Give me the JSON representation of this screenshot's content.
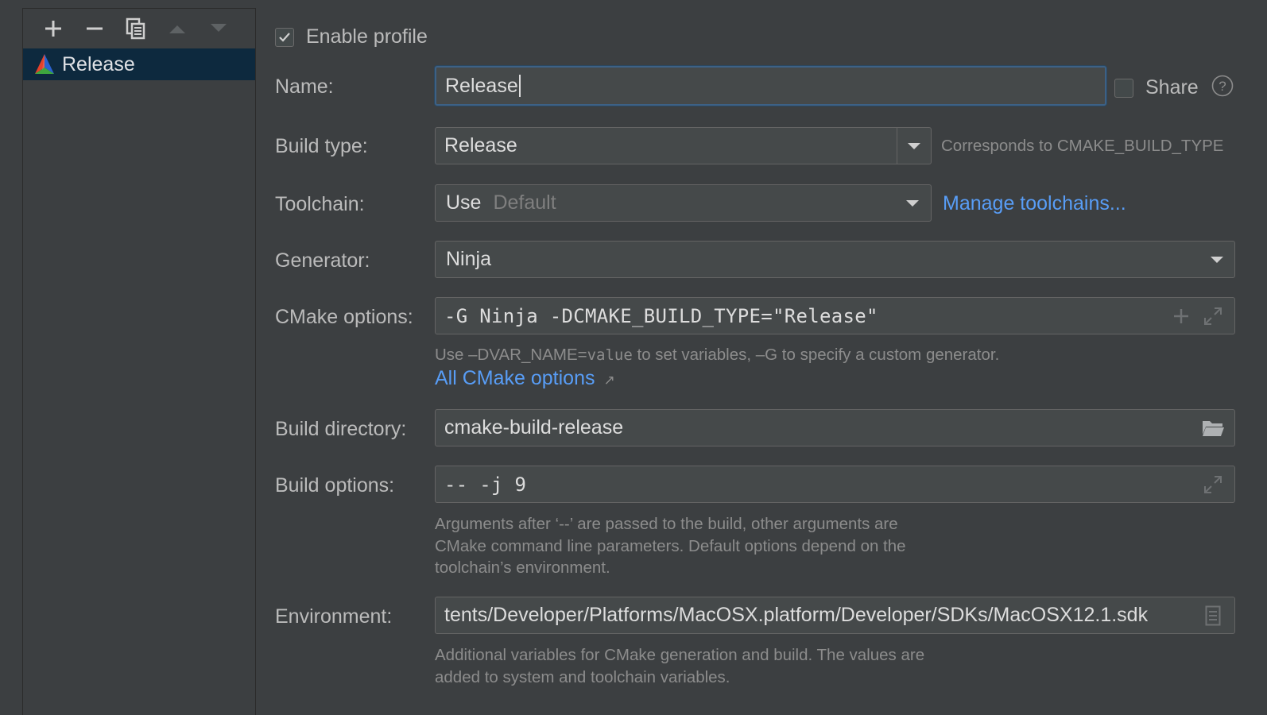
{
  "profiles": {
    "items": [
      {
        "label": "Release",
        "icon": "cmake-logo-icon"
      }
    ],
    "toolbar_icons": [
      "add-icon",
      "remove-icon",
      "copy-icon",
      "move-up-icon",
      "move-down-icon"
    ]
  },
  "form": {
    "enable_profile_label": "Enable profile",
    "enable_profile_checked": true,
    "name_label": "Name:",
    "name_value": "Release",
    "share_label": "Share",
    "share_checked": false,
    "build_type_label": "Build type:",
    "build_type_value": "Release",
    "build_type_hint": "Corresponds to CMAKE_BUILD_TYPE",
    "toolchain_label": "Toolchain:",
    "toolchain_use": "Use",
    "toolchain_value": "Default",
    "manage_toolchains_link": "Manage toolchains...",
    "generator_label": "Generator:",
    "generator_value": "Ninja",
    "cmake_options_label": "CMake options:",
    "cmake_options_value": "-G Ninja -DCMAKE_BUILD_TYPE=\"Release\"",
    "cmake_hint_1": "Use –DVAR_NAME=",
    "cmake_hint_code": "value",
    "cmake_hint_2": " to set variables, –G to specify a custom generator.",
    "all_cmake_options_link": "All CMake options",
    "all_cmake_options_arrow": "↗",
    "build_dir_label": "Build directory:",
    "build_dir_value": "cmake-build-release",
    "build_options_label": "Build options:",
    "build_options_value": "-- -j 9",
    "build_options_hint": [
      "Arguments after ‘--’ are passed to the build, other arguments are",
      "CMake command line parameters. Default options depend on the",
      "toolchain’s environment."
    ],
    "environment_label": "Environment:",
    "environment_value": "tents/Developer/Platforms/MacOSX.platform/Developer/SDKs/MacOSX12.1.sdk",
    "environment_hint": [
      "Additional variables for CMake generation and build. The values are",
      "added to system and toolchain variables."
    ]
  },
  "colors": {
    "background": "#3c3f41",
    "field_bg": "#45494a",
    "selection": "#0d293e",
    "focus_border": "#3d6185",
    "link": "#589df6",
    "hint_text": "#8c8c8c"
  }
}
